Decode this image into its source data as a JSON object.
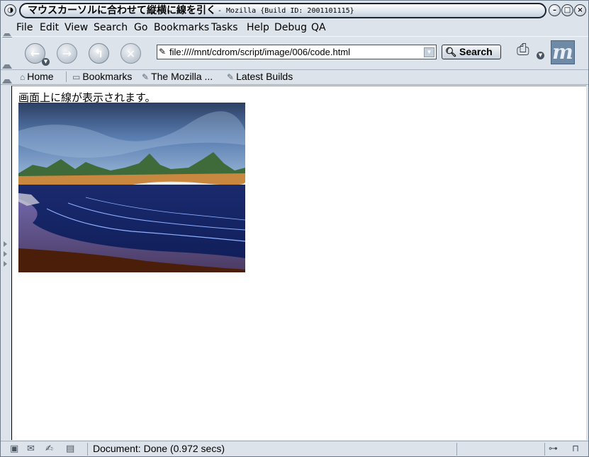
{
  "window": {
    "title": "マウスカーソルに合わせて縦横に線を引く",
    "subtitle": "- Mozilla {Build ID: 2001101115}"
  },
  "menubar": {
    "items": [
      "File",
      "Edit",
      "View",
      "Search",
      "Go",
      "Bookmarks",
      "Tasks",
      "Help",
      "Debug",
      "QA"
    ]
  },
  "navbar": {
    "url": "file:////mnt/cdrom/script/image/006/code.html",
    "search_label": "Search"
  },
  "personal_toolbar": {
    "items": [
      "Home",
      "Bookmarks",
      "The Mozilla ...",
      "Latest Builds"
    ]
  },
  "content": {
    "text": "画面上に線が表示されます。"
  },
  "statusbar": {
    "text": "Document: Done (0.972 secs)"
  },
  "icons": {
    "back": "back-arrow-icon",
    "forward": "forward-arrow-icon",
    "reload": "reload-icon",
    "stop": "stop-icon",
    "home": "home-icon",
    "bookmarks": "folder-icon",
    "link": "bookmark-link-icon",
    "print": "print-icon",
    "throbber": "mozilla-logo-icon"
  },
  "colors": {
    "chrome": "#dde3ea",
    "content_bg": "#ffffff",
    "throbber": "#6f8aa7"
  }
}
